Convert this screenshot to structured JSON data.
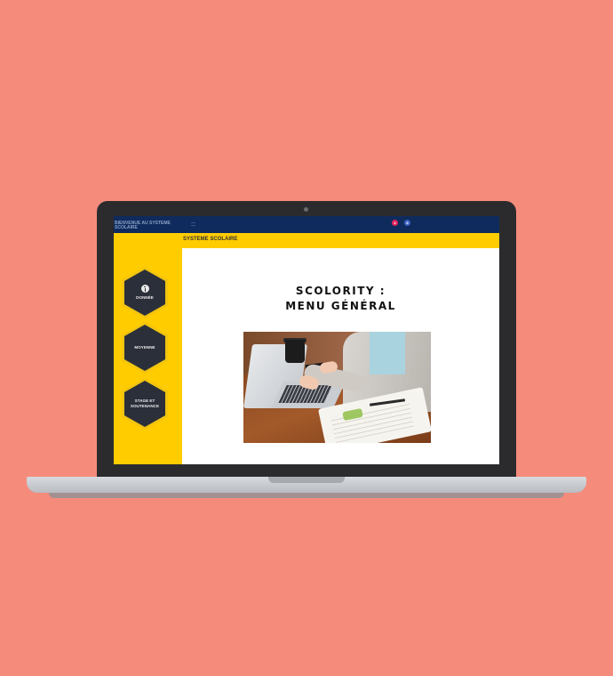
{
  "topbar": {
    "brand": "BIENVENUE AU SYSTEME SCOLAIRE",
    "notifications": [
      "4",
      "8"
    ]
  },
  "page": {
    "section_title": "SYSTEME SCOLAIRE",
    "heading_line1": "SCOLORITY :",
    "heading_line2": "MENU GÉNÉRAL"
  },
  "sidebar": {
    "items": [
      {
        "label": "DONNÉE",
        "icon": "info-icon"
      },
      {
        "label": "MOYENNE"
      },
      {
        "label": "STAGE ET SOUTENANCE"
      }
    ]
  },
  "photo": {
    "subject": "person-typing-on-laptop"
  },
  "colors": {
    "background": "#f58b7b",
    "topbar": "#0f2a5c",
    "accent": "#ffcc00",
    "hexagon": "#2b2f3a",
    "badge_red": "#e2245a",
    "badge_blue": "#3d64c6"
  }
}
